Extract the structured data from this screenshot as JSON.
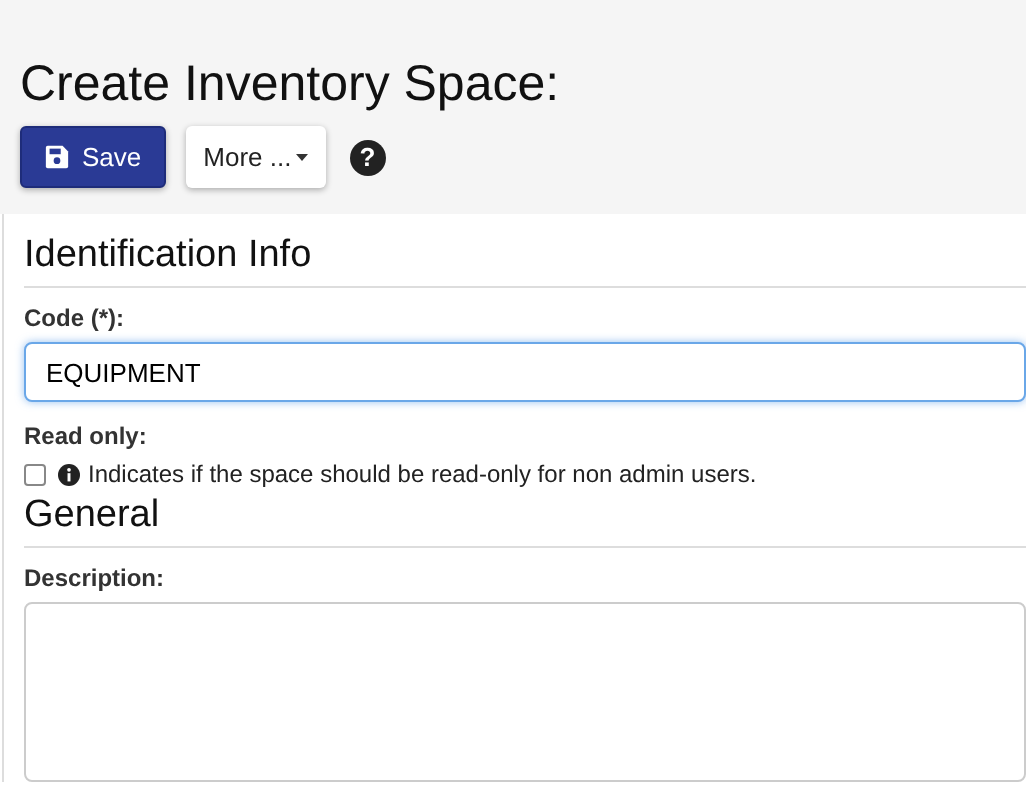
{
  "page": {
    "title": "Create Inventory Space:"
  },
  "toolbar": {
    "save": {
      "label": "Save"
    },
    "more": {
      "label": "More ..."
    },
    "help": {
      "label": "?"
    }
  },
  "sections": [
    {
      "title": "Identification Info",
      "fields": [
        {
          "kind": "text",
          "label": "Code (*):",
          "value": "EQUIPMENT",
          "focused": true
        },
        {
          "kind": "checkbox",
          "label": "Read only:",
          "checked": false,
          "hint": "Indicates if the space should be read-only for non admin users."
        }
      ]
    },
    {
      "title": "General",
      "fields": [
        {
          "kind": "textarea",
          "label": "Description:"
        }
      ]
    }
  ]
}
